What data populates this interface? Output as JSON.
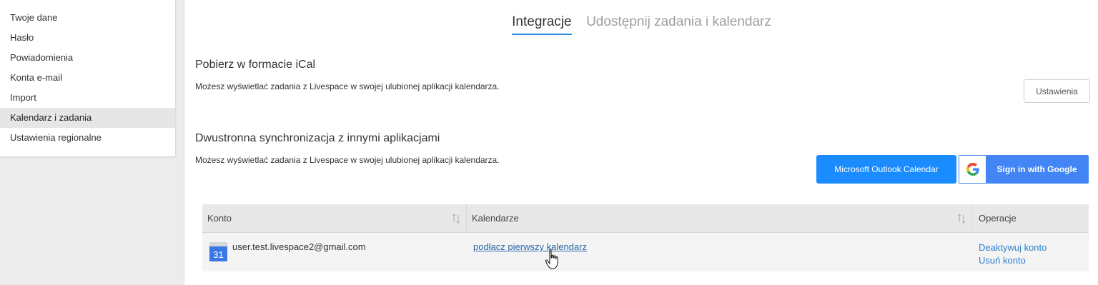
{
  "sidebar": {
    "items": [
      {
        "label": "Twoje dane"
      },
      {
        "label": "Hasło"
      },
      {
        "label": "Powiadomienia"
      },
      {
        "label": "Konta e-mail"
      },
      {
        "label": "Import"
      },
      {
        "label": "Kalendarz i zadania",
        "active": true
      },
      {
        "label": "Ustawienia regionalne"
      }
    ]
  },
  "tabs": [
    {
      "label": "Integracje",
      "active": true
    },
    {
      "label": "Udostępnij zadania i kalendarz",
      "active": false
    }
  ],
  "ical": {
    "title": "Pobierz w formacie iCal",
    "description": "Możesz wyświetlać zadania z Livespace w swojej ulubionej aplikacji kalendarza.",
    "settings_button": "Ustawienia"
  },
  "sync": {
    "title": "Dwustronna synchronizacja z innymi aplikacjami",
    "description": "Możesz wyświetlać zadania z Livespace w swojej ulubionej aplikacji kalendarza.",
    "outlook_button": "Microsoft Outlook Calendar",
    "google_button": "Sign in with Google"
  },
  "table": {
    "headers": {
      "account": "Konto",
      "calendars": "Kalendarze",
      "operations": "Operacje"
    },
    "rows": [
      {
        "calendar_icon_day": "31",
        "account": "user.test.livespace2@gmail.com",
        "calendars_link": "podłącz pierwszy kalendarz",
        "op_deactivate": "Deaktywuj konto",
        "op_remove": "Usuń konto"
      }
    ]
  },
  "icons": {
    "google": "google-g-icon",
    "calendar": "google-calendar-icon",
    "sort": "sort-arrows-icon",
    "cursor": "hand-pointer-icon"
  },
  "colors": {
    "primary_blue": "#1a8cff",
    "google_blue": "#4285f4",
    "tab_underline": "#2d8de3",
    "link": "#2a6aa8"
  }
}
